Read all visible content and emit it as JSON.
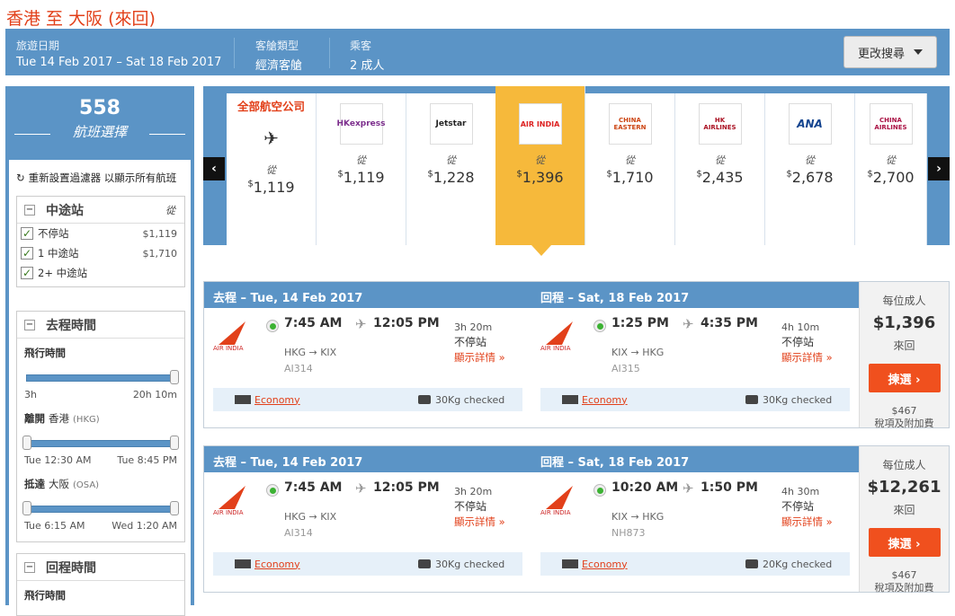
{
  "page_title": "香港 至 大阪 (來回)",
  "topbar": {
    "date_label": "旅遊日期",
    "date_value": "Tue 14 Feb 2017 – Sat 18 Feb 2017",
    "cabin_label": "客艙類型",
    "cabin_value": "經濟客艙",
    "pax_label": "乘客",
    "pax_value": "2 成人",
    "modify_label": "更改搜尋"
  },
  "sidebar": {
    "count": "558",
    "count_label": "航班選擇",
    "reset_label": "重新設置過濾器 以顯示所有航班",
    "stops": {
      "title": "中途站",
      "from_label": "從",
      "items": [
        {
          "label": "不停站",
          "price": "$1,119"
        },
        {
          "label": "1 中途站",
          "price": "$1,710"
        },
        {
          "label": "2+ 中途站",
          "price": ""
        }
      ]
    },
    "outbound": {
      "title": "去程時間",
      "flight_time_label": "飛行時間",
      "ft_min": "3h",
      "ft_max": "20h 10m",
      "depart_label": "離開",
      "depart_city": "香港",
      "depart_code": "(HKG)",
      "dep_min": "Tue 12:30 AM",
      "dep_max": "Tue 8:45 PM",
      "arrive_label": "抵達",
      "arrive_city": "大阪",
      "arrive_code": "(OSA)",
      "arr_min": "Tue 6:15 AM",
      "arr_max": "Wed 1:20 AM"
    },
    "return": {
      "title": "回程時間",
      "flight_time_label": "飛行時間"
    }
  },
  "carousel": {
    "airlines": [
      {
        "name": "全部航空公司",
        "logo": "ALL",
        "from": "從",
        "price": "1,119"
      },
      {
        "name": "HK express",
        "logo": "HKexpress",
        "from": "從",
        "price": "1,119"
      },
      {
        "name": "Jetstar",
        "logo": "Jetstar",
        "from": "從",
        "price": "1,228"
      },
      {
        "name": "Air India",
        "logo": "AIR INDIA",
        "from": "從",
        "price": "1,396"
      },
      {
        "name": "China Eastern",
        "logo": "CHINA EASTERN",
        "from": "從",
        "price": "1,710"
      },
      {
        "name": "Hong Kong Airlines",
        "logo": "HK AIRLINES",
        "from": "從",
        "price": "2,435"
      },
      {
        "name": "ANA",
        "logo": "ANA",
        "from": "從",
        "price": "2,678"
      },
      {
        "name": "China Airlines",
        "logo": "CHINA AIRLINES",
        "from": "從",
        "price": "2,700"
      }
    ],
    "currency": "$",
    "prev": "‹",
    "next": "›"
  },
  "results": [
    {
      "out": {
        "head": "去程 – Tue, 14 Feb 2017",
        "dep": "7:45 AM",
        "arr": "12:05 PM",
        "route": "HKG → KIX",
        "flight": "AI314",
        "dur": "3h 20m",
        "stop": "不停站",
        "details": "顯示詳情 »",
        "cabin": "Economy",
        "bag": "30Kg checked"
      },
      "ret": {
        "head": "回程 – Sat, 18 Feb 2017",
        "dep": "1:25 PM",
        "arr": "4:35 PM",
        "route": "KIX → HKG",
        "flight": "AI315",
        "dur": "4h 10m",
        "stop": "不停站",
        "details": "顯示詳情 »",
        "cabin": "Economy",
        "bag": "30Kg checked"
      },
      "price_label": "每位成人",
      "price": "$1,396",
      "trip": "來回",
      "select": "揀選 ›",
      "tax": "$467",
      "tax_label": "稅項及附加費"
    },
    {
      "out": {
        "head": "去程 – Tue, 14 Feb 2017",
        "dep": "7:45 AM",
        "arr": "12:05 PM",
        "route": "HKG → KIX",
        "flight": "AI314",
        "dur": "3h 20m",
        "stop": "不停站",
        "details": "顯示詳情 »",
        "cabin": "Economy",
        "bag": "30Kg checked"
      },
      "ret": {
        "head": "回程 – Sat, 18 Feb 2017",
        "dep": "10:20 AM",
        "arr": "1:50 PM",
        "route": "KIX → HKG",
        "flight": "NH873",
        "dur": "4h 30m",
        "stop": "不停站",
        "details": "顯示詳情 »",
        "cabin": "Economy",
        "bag": "20Kg checked"
      },
      "price_label": "每位成人",
      "price": "$12,261",
      "trip": "來回",
      "select": "揀選 ›",
      "tax": "$467",
      "tax_label": "稅項及附加費"
    }
  ],
  "colors": {
    "accent": "#e2401a",
    "bar": "#5b94c6",
    "selected": "#f6b93b"
  }
}
